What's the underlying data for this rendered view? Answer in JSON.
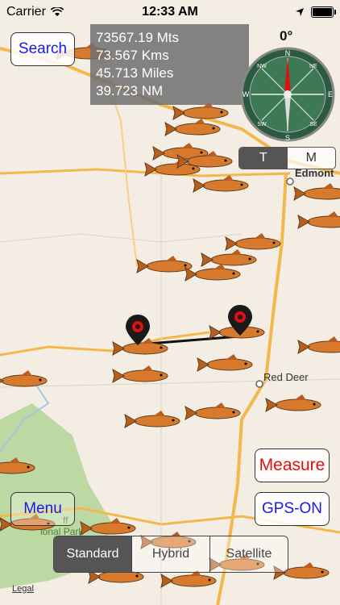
{
  "status": {
    "carrier": "Carrier",
    "time": "12:33 AM"
  },
  "search_label": "Search",
  "distance": {
    "meters": "73567.19 Mts",
    "kms": "73.567 Kms",
    "miles": "45.713 Miles",
    "nm": "39.723 NM"
  },
  "compass": {
    "heading": "0°",
    "n": "N",
    "e": "E",
    "s": "S",
    "w": "W",
    "ne": "NE",
    "nw": "NW",
    "se": "SE",
    "sw": "SW"
  },
  "unit_toggle": {
    "t": "T",
    "m": "M"
  },
  "map_labels": {
    "edmonton": "Edmont",
    "red_deer": "Red Deer",
    "park": "ional Park",
    "park2": "ff"
  },
  "buttons": {
    "measure": "Measure",
    "gps": "GPS-ON",
    "menu": "Menu"
  },
  "map_type": {
    "standard": "Standard",
    "hybrid": "Hybrid",
    "satellite": "Satellite"
  },
  "legal": "Legal",
  "colors": {
    "link_blue": "#1a1ae0",
    "measure_red": "#e01010",
    "road": "#f2b84b",
    "park_green": "#bcd8a3"
  }
}
